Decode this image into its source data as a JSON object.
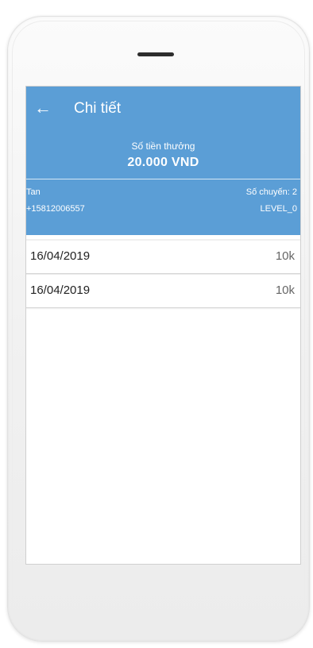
{
  "colors": {
    "header_bg": "#5b9ed6",
    "phone_body": "#f4f4f4",
    "screen_bg": "#ffffff"
  },
  "appbar": {
    "back_icon": "arrow-left-icon",
    "back_glyph": "←",
    "title": "Chi tiết"
  },
  "bonus": {
    "label": "Số tiền thưởng",
    "amount": "20.000 VND"
  },
  "user": {
    "name": "Tan",
    "phone": "+15812006557",
    "trips_label": "Số chuyến: 2",
    "level": "LEVEL_0"
  },
  "items": [
    {
      "date": "16/04/2019",
      "value": "10k"
    },
    {
      "date": "16/04/2019",
      "value": "10k"
    }
  ]
}
